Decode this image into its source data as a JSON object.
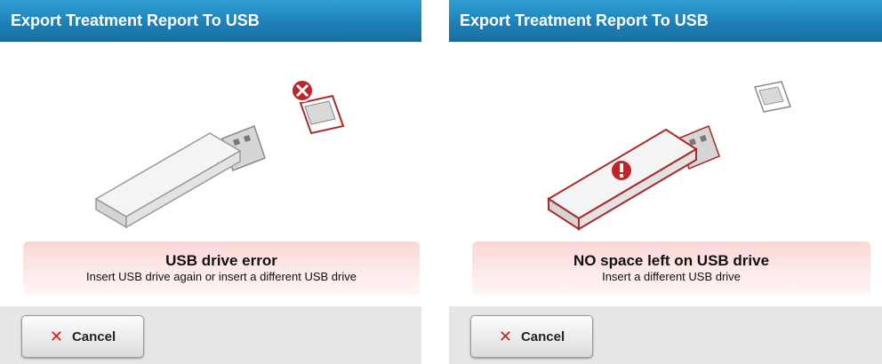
{
  "panels": [
    {
      "title": "Export Treatment Report To USB",
      "message_title": "USB drive error",
      "message_subtitle": "Insert USB drive again or insert a different USB drive",
      "cancel_label": "Cancel"
    },
    {
      "title": "Export Treatment Report To USB",
      "message_title": "NO space left on USB drive",
      "message_subtitle": "Insert a different USB drive",
      "cancel_label": "Cancel"
    }
  ],
  "icons": {
    "cancel": "close-icon",
    "port_error": "error-x-icon",
    "drive_warning": "exclamation-icon"
  },
  "colors": {
    "titlebar": "#1c7fb6",
    "error_red": "#c0242b",
    "message_bg": "#fbd6d6"
  }
}
